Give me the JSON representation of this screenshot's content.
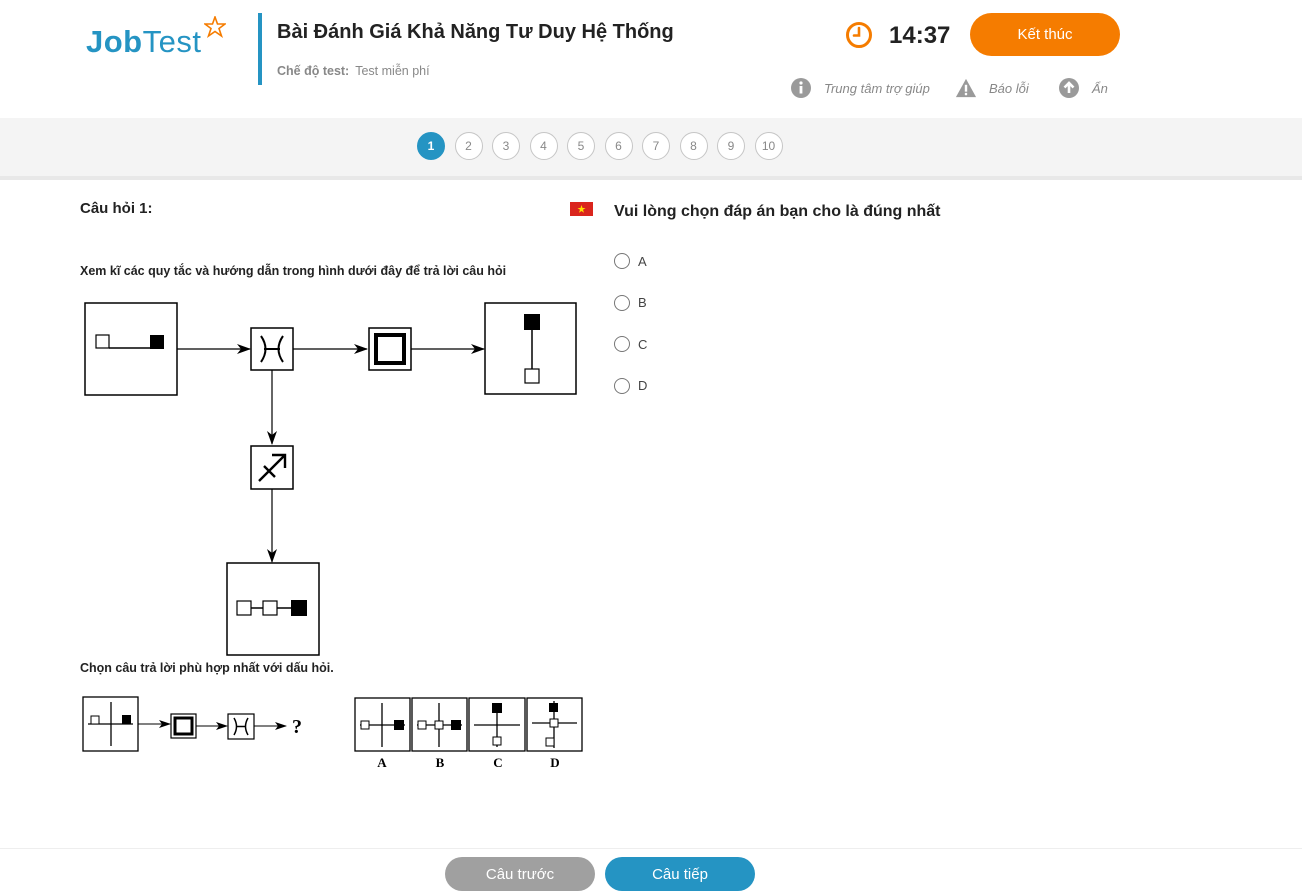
{
  "brand": {
    "logo_bold": "Job",
    "logo_light": "Test"
  },
  "header": {
    "title": "Bài Đánh Giá Khả Năng Tư Duy Hệ Thống",
    "mode_label": "Chế độ test:",
    "mode_value": "Test miễn phí",
    "timer": "14:37",
    "end_button": "Kết thúc",
    "tools": [
      {
        "label": "Trung tâm trợ giúp",
        "icon": "info-icon"
      },
      {
        "label": "Báo lỗi",
        "icon": "warning-icon"
      },
      {
        "label": "Ẩn",
        "icon": "arrow-up-icon"
      }
    ]
  },
  "pager": {
    "pages": [
      "1",
      "2",
      "3",
      "4",
      "5",
      "6",
      "7",
      "8",
      "9",
      "10"
    ],
    "active": 1
  },
  "question": {
    "label": "Câu hỏi 1:",
    "instruction": "Xem kĩ các quy tắc và hướng dẫn trong hình dưới đây để trả lời câu hỏi",
    "choose_text": "Chọn câu trả lời phù hợp nhất với dấu hỏi.",
    "prompt": "Vui lòng chọn đáp án bạn cho là đúng nhất",
    "options": [
      "A",
      "B",
      "C",
      "D"
    ],
    "figure_labels": [
      "A",
      "B",
      "C",
      "D"
    ],
    "question_mark": "?"
  },
  "footer": {
    "prev": "Câu trước",
    "next": "Câu tiếp"
  },
  "colors": {
    "accent": "#2594c3",
    "orange": "#f57c00",
    "gray_button": "#a0a0a0",
    "flag_red": "#da251d",
    "flag_star": "#ffde00"
  }
}
